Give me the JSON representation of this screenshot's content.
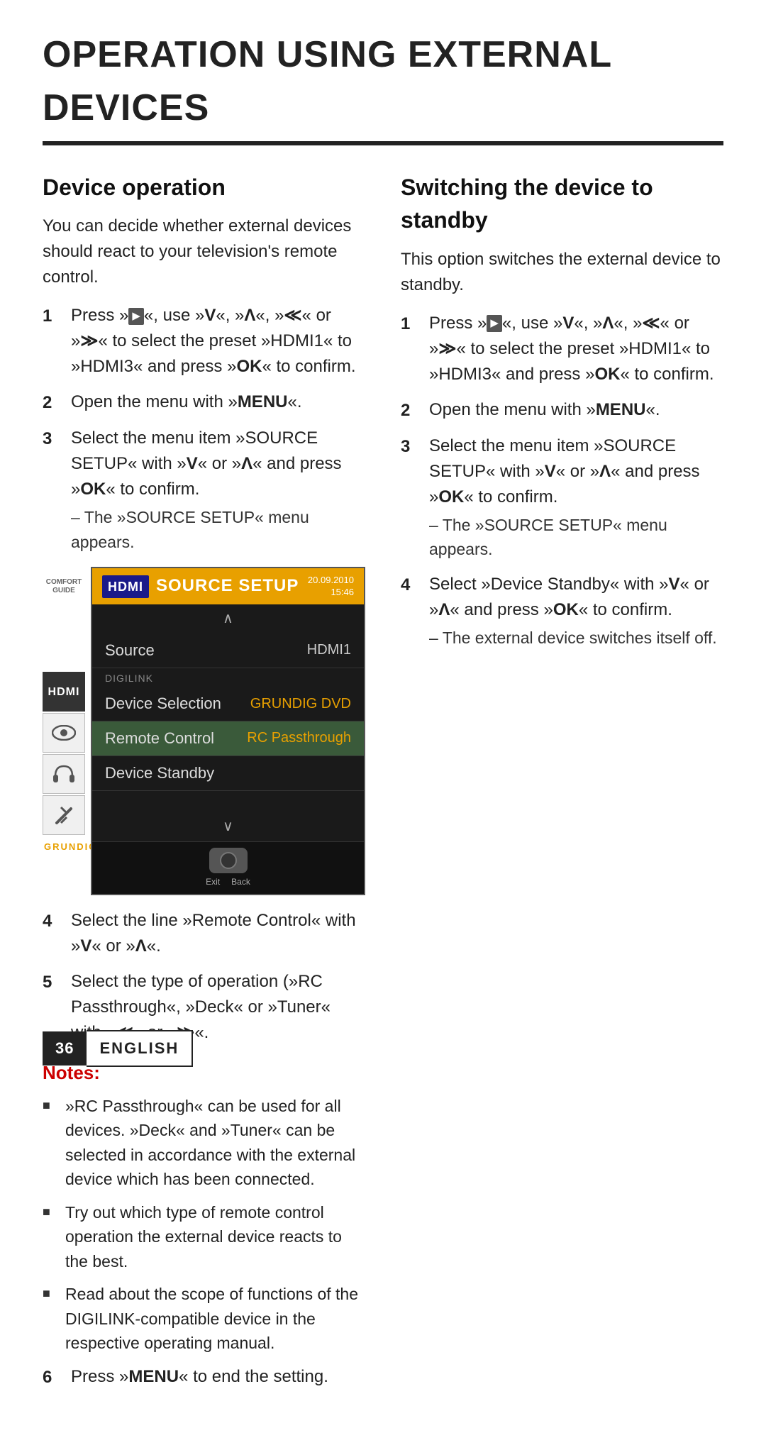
{
  "page": {
    "title": "OPERATION USING EXTERNAL DEVICES"
  },
  "left_section": {
    "heading": "Device operation",
    "intro": "You can decide whether external devices should react to your television's remote control.",
    "steps": [
      {
        "num": "1",
        "text": "Press »",
        "bold_parts": [
          "OK"
        ],
        "full": "Press »⮕«, use »V«, »Λ«, »≪« or »≫« to select the preset »HDMI1« to »HDMI3« and press »OK« to confirm."
      },
      {
        "num": "2",
        "full": "Open the menu with »MENU«."
      },
      {
        "num": "3",
        "full": "Select the menu item »SOURCE SETUP« with »V« or »Λ« and press »OK« to confirm.",
        "sub": "– The »SOURCE SETUP« menu appears."
      },
      {
        "num": "4",
        "full": "Select the line »Remote Control« with »V« or »Λ«."
      },
      {
        "num": "5",
        "full": "Select the type of operation (»RC Passthrough«, »Deck« or »Tuner« with »≪« or »≫«."
      }
    ],
    "notes_title": "Notes:",
    "notes": [
      "»RC Passthrough« can be used for all devices. »Deck« and »Tuner« can be selected in accordance with the external device which has been connected.",
      "Try out which type of remote control operation the external device reacts to the best.",
      "Read about the scope of functions of the DIGILINK-compatible device in the respective operating manual."
    ],
    "step6": "Press »MENU« to end the setting."
  },
  "right_section": {
    "heading": "Switching the device to standby",
    "intro": "This option switches the external device to standby.",
    "steps": [
      {
        "num": "1",
        "full": "Press »⮕«, use »V«, »Λ«, »≪« or »≫« to select the preset »HDMI1« to »HDMI3« and press »OK« to confirm."
      },
      {
        "num": "2",
        "full": "Open the menu with »MENU«."
      },
      {
        "num": "3",
        "full": "Select the menu item »SOURCE SETUP« with »V« or »Λ« and press »OK« to confirm.",
        "sub": "– The »SOURCE SETUP« menu appears."
      },
      {
        "num": "4",
        "full": "Select »Device Standby« with »V« or »Λ« and press »OK« to confirm.",
        "sub": "– The external device switches itself off."
      }
    ]
  },
  "tv_menu": {
    "header": {
      "badge": "HDMI",
      "title": "SOURCE SETUP",
      "date": "20.09.2010",
      "time": "15:46"
    },
    "rows": [
      {
        "label": "Source",
        "value": "HDMI1",
        "highlighted": false,
        "digilink": false
      },
      {
        "label": "DIGILINK",
        "value": "",
        "highlighted": false,
        "digilink": true
      },
      {
        "label": "Device Selection",
        "value": "GRUNDIG DVD",
        "highlighted": false,
        "digilink": false
      },
      {
        "label": "Remote Control",
        "value": "RC Passthrough",
        "highlighted": true,
        "digilink": false
      },
      {
        "label": "Device Standby",
        "value": "",
        "highlighted": false,
        "digilink": false
      }
    ],
    "exit_label": "Exit",
    "back_label": "Back",
    "grundig": "GRUNDIG"
  },
  "sidebar_icons": [
    {
      "label": "COMFORT\nGUIDE",
      "type": "guide"
    },
    {
      "label": "HDMI",
      "type": "hdmi"
    },
    {
      "label": "eye",
      "type": "eye"
    },
    {
      "label": "audio",
      "type": "audio"
    },
    {
      "label": "tools",
      "type": "tools"
    }
  ],
  "footer": {
    "number": "36",
    "language": "ENGLISH"
  }
}
